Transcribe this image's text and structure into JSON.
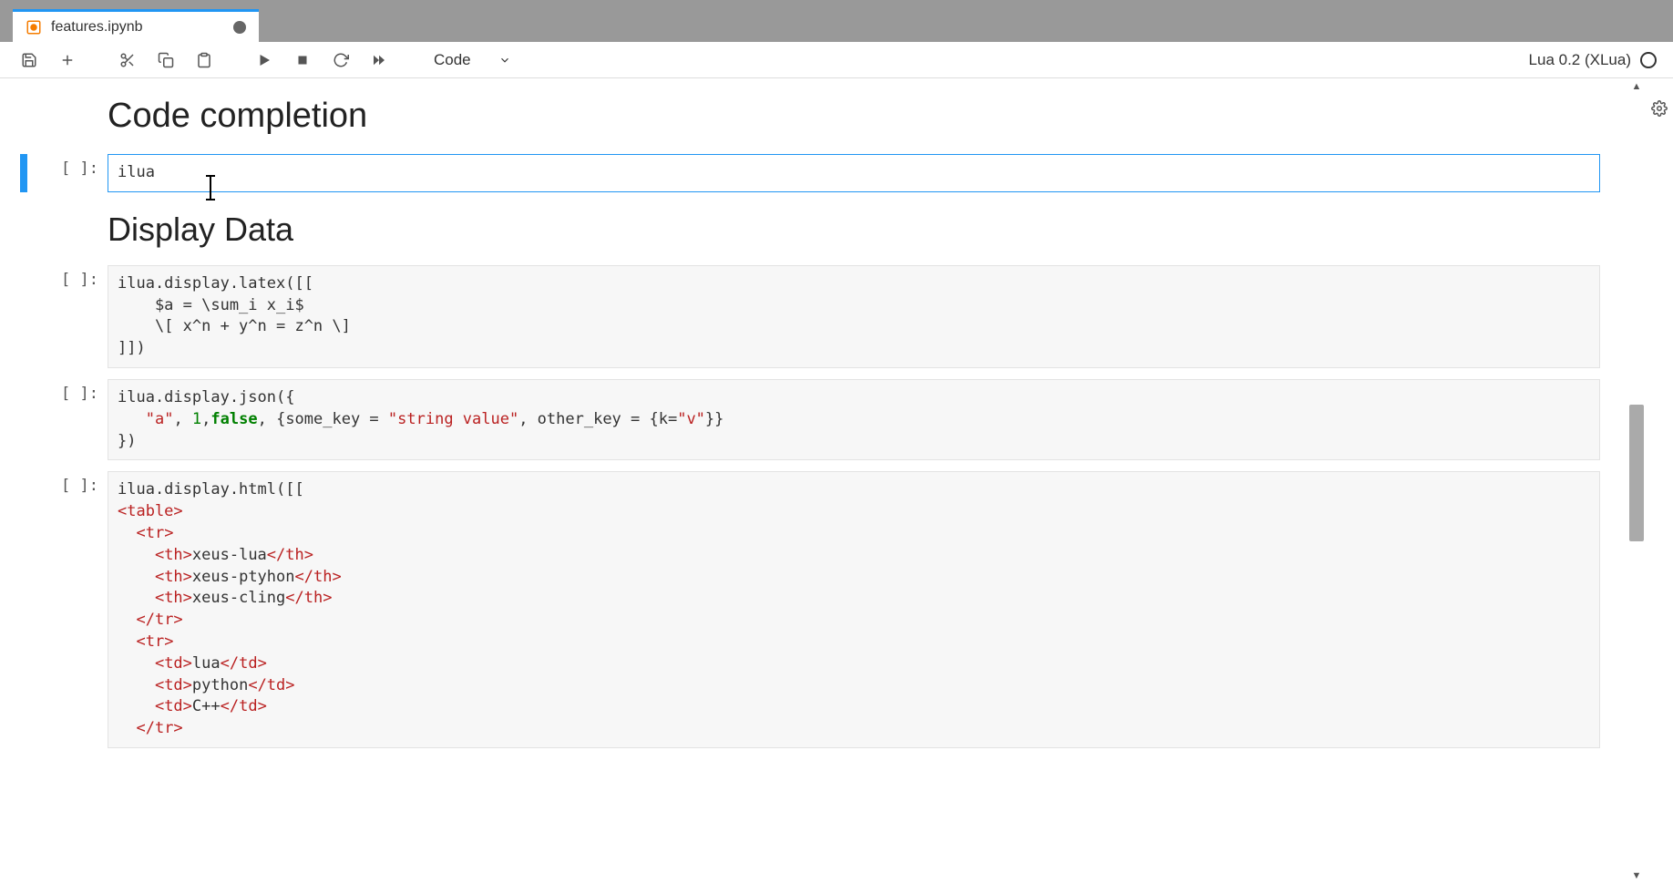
{
  "tab": {
    "title": "features.ipynb"
  },
  "toolbar": {
    "cell_type": "Code",
    "kernel_name": "Lua 0.2 (XLua)"
  },
  "headings": {
    "h1": "Code completion",
    "h2": "Display Data"
  },
  "cells": {
    "c0": {
      "prompt": "[ ]:",
      "code": "ilua"
    },
    "c1": {
      "prompt": "[ ]:"
    },
    "c2": {
      "prompt": "[ ]:"
    },
    "c3": {
      "prompt": "[ ]:"
    }
  }
}
